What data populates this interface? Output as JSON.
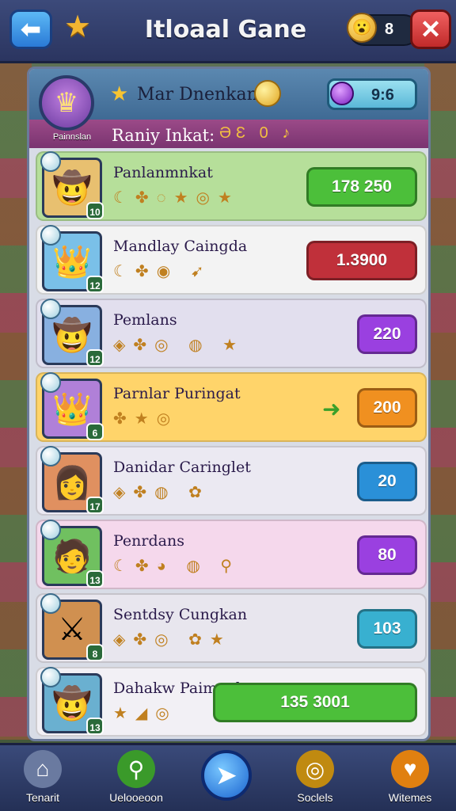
{
  "topbar": {
    "title": "Itloaal Gane",
    "coin_count": "8",
    "back_glyph": "⬅",
    "close_glyph": "✕",
    "star_glyph": "★",
    "emoji_glyph": "😮"
  },
  "panel": {
    "player_name": "Mar Dnenkan",
    "player_label": "Painnslan",
    "timer": "9:6",
    "rank_label": "Raniy Inkat:",
    "rank_icons": "ƏƐ 0 ♪",
    "avatar_glyph": "♛",
    "header_star": "★"
  },
  "rows": [
    {
      "name": "Panlanmnkat",
      "badge": "10",
      "icons": "☾✤◌★◎★",
      "button": "178  250",
      "btn_color": "#4cbf3a",
      "row_bg": "#b6df9a",
      "avatar_bg": "#e8c070",
      "avatar_glyph": "🤠"
    },
    {
      "name": "Mandlay Caingda",
      "badge": "12",
      "icons": "☾✤◉ ➹",
      "button": "1.3900",
      "btn_color": "#c0303a",
      "row_bg": "#f3f3f3",
      "avatar_bg": "#7ac0e8",
      "avatar_glyph": "👑"
    },
    {
      "name": "Pemlans",
      "badge": "12",
      "icons": "◈✤◎ ◍ ★",
      "button": "220",
      "btn_color": "#9a40e0",
      "row_bg": "#e2dfee",
      "avatar_bg": "#88b0e0",
      "avatar_glyph": "🤠"
    },
    {
      "name": "Parnlar Puringat",
      "badge": "6",
      "icons": "✤★◎",
      "button": "200",
      "btn_color": "#f09020",
      "row_bg": "#ffd46a",
      "avatar_bg": "#b080d8",
      "avatar_glyph": "👑",
      "extra": "➜"
    },
    {
      "name": "Danidar Caringlet",
      "badge": "17",
      "icons": "◈✤◍ ✿",
      "button": "20",
      "btn_color": "#2a90d8",
      "row_bg": "#ebe9f2",
      "avatar_bg": "#e09060",
      "avatar_glyph": "👩"
    },
    {
      "name": "Penrdans",
      "badge": "13",
      "icons": "☾✤◕ ◍ ⚲",
      "button": "80",
      "btn_color": "#9a40e0",
      "row_bg": "#f5d8ec",
      "avatar_bg": "#70c060",
      "avatar_glyph": "🧑"
    },
    {
      "name": "Sentdsy Cungkan",
      "badge": "8",
      "icons": "◈✤◎ ✿★",
      "button": "103",
      "btn_color": "#38b0d0",
      "row_bg": "#e8e6ee",
      "avatar_bg": "#d09050",
      "avatar_glyph": "⚔"
    },
    {
      "name": "Dahakw Paimpah",
      "badge": "13",
      "icons": "★◢◎",
      "button": "135 3001",
      "btn_color": "#4cbf3a",
      "row_bg": "#f2f0f5",
      "avatar_bg": "#6ab0d0",
      "avatar_glyph": "🤠",
      "wide": true
    }
  ],
  "nav": [
    {
      "label": "Tenarit",
      "glyph": "⌂",
      "color": "#9aa6c0"
    },
    {
      "label": "Uelooeoon",
      "glyph": "⚲",
      "color": "#4cbf3a"
    },
    {
      "label": "Soclels",
      "glyph": "◎",
      "color": "#e0a520"
    },
    {
      "label": "Witemes",
      "glyph": "♥",
      "color": "#f0a020"
    }
  ],
  "nav_center_glyph": "➤"
}
